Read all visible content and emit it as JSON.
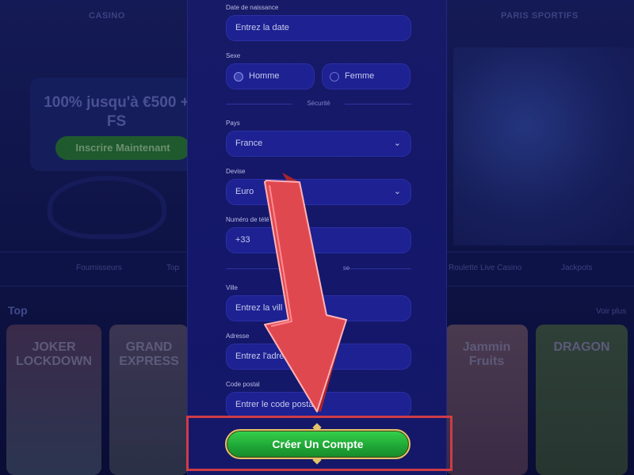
{
  "background": {
    "tabs": [
      "CASINO",
      "PARIS SPORTIFS"
    ],
    "promo": {
      "small_text": "",
      "title": "100% jusqu'à €500 + FS",
      "button": "Inscrire Maintenant"
    },
    "nav_items": [
      "Fournisseurs",
      "Top",
      "Roulette Live Casino",
      "Jackpots"
    ],
    "section_title": "Top",
    "see_all": "Voir plus",
    "games": [
      "JOKER LOCKDOWN",
      "GRAND EXPRESS",
      "Jammin Fruits",
      "DRAGON"
    ]
  },
  "form": {
    "birthdate": {
      "label": "Date de naissance",
      "placeholder": "Entrez la date"
    },
    "gender": {
      "label": "Sexe",
      "options": [
        "Homme",
        "Femme"
      ],
      "selected": "Homme"
    },
    "security_divider": "Sécurité",
    "country": {
      "label": "Pays",
      "value": "France"
    },
    "currency": {
      "label": "Devise",
      "value": "Euro"
    },
    "phone": {
      "label": "Numéro de télé",
      "value": "+33"
    },
    "address_divider": "se",
    "city": {
      "label": "Ville",
      "placeholder": "Entrez la vill"
    },
    "address": {
      "label": "Adresse",
      "placeholder": "Entrez l'adres"
    },
    "postal": {
      "label": "Code postal",
      "placeholder": "Entrer le code posta"
    },
    "submit": "Créer Un Compte"
  },
  "colors": {
    "modal_bg": "#171a66",
    "field_bg": "#1d2191",
    "cta_green": "#20a837",
    "highlight_red": "#cf3b47",
    "arrow_red": "#e04850"
  },
  "icons": {
    "chevron": "chevron-down-icon",
    "arrow": "red-down-arrow-icon"
  }
}
